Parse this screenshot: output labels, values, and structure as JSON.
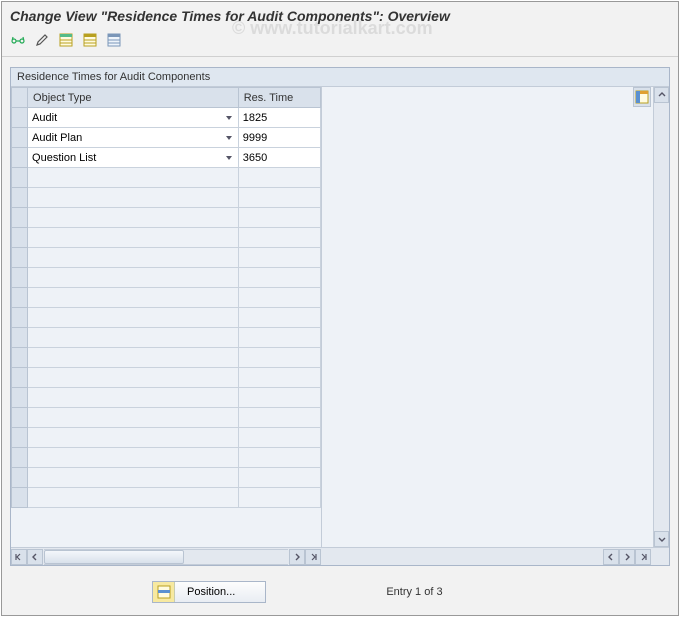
{
  "title": "Change View \"Residence Times for Audit Components\": Overview",
  "watermark": "© www.tutorialkart.com",
  "toolbar": {
    "btn1": "other-view",
    "btn2": "change-mode",
    "btn3": "new-entries",
    "btn4": "copy-as",
    "btn5": "delete"
  },
  "panel": {
    "title": "Residence Times for Audit Components",
    "columns": {
      "object_type": "Object Type",
      "res_time": "Res. Time"
    },
    "rows": [
      {
        "object_type": "Audit",
        "res_time": "1825"
      },
      {
        "object_type": "Audit Plan",
        "res_time": "9999"
      },
      {
        "object_type": "Question List",
        "res_time": "3650"
      }
    ],
    "empty_row_count": 17
  },
  "footer": {
    "position_label": "Position...",
    "entry_text": "Entry 1 of 3"
  }
}
